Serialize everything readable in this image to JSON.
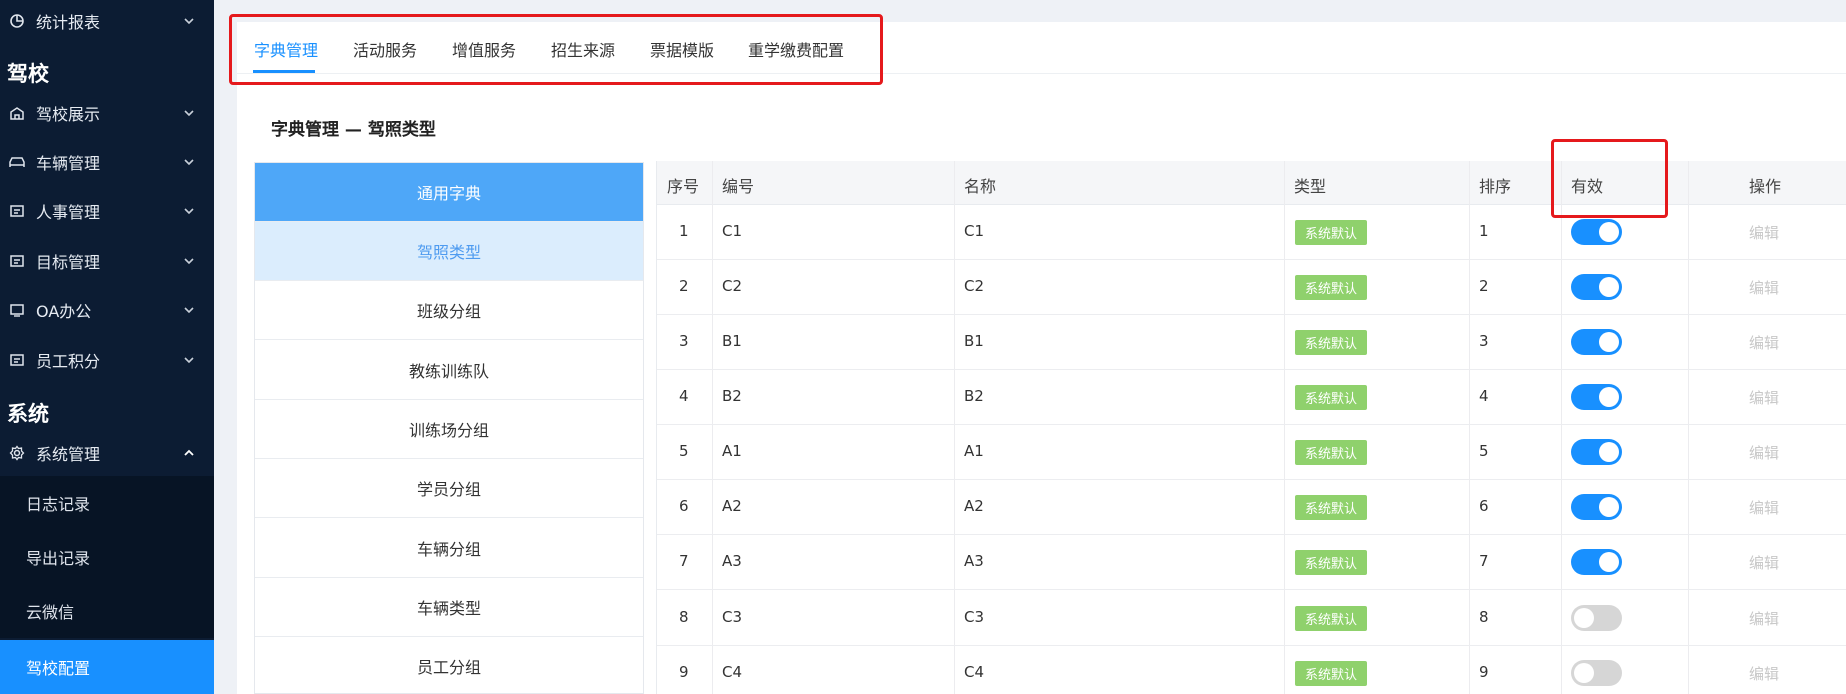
{
  "sidebar": {
    "top_item": {
      "label": "统计报表",
      "icon": "pie-chart-icon"
    },
    "section_school": "驾校",
    "school_items": [
      {
        "label": "驾校展示",
        "icon": "building-icon"
      },
      {
        "label": "车辆管理",
        "icon": "car-icon"
      },
      {
        "label": "人事管理",
        "icon": "id-card-icon"
      },
      {
        "label": "目标管理",
        "icon": "id-card-icon"
      },
      {
        "label": "OA办公",
        "icon": "oa-icon"
      },
      {
        "label": "员工积分",
        "icon": "id-card-icon"
      }
    ],
    "section_system": "系统",
    "system_item": {
      "label": "系统管理",
      "icon": "gear-icon"
    },
    "sub_items": [
      "日志记录",
      "导出记录",
      "云微信",
      "驾校配置"
    ],
    "active_sub": "驾校配置"
  },
  "tabs": [
    "字典管理",
    "活动服务",
    "增值服务",
    "招生来源",
    "票据模版",
    "重学缴费配置"
  ],
  "active_tab": "字典管理",
  "page_title": "字典管理 — 驾照类型",
  "dict_list": [
    "通用字典",
    "驾照类型",
    "班级分组",
    "教练训练队",
    "训练场分组",
    "学员分组",
    "车辆分组",
    "车辆类型",
    "员工分组"
  ],
  "table": {
    "headers": [
      "序号",
      "编号",
      "名称",
      "类型",
      "排序",
      "有效",
      "操作"
    ],
    "rows": [
      {
        "seq": "1",
        "code": "C1",
        "name": "C1",
        "type": "系统默认",
        "sort": "1",
        "enabled": true,
        "action": "编辑"
      },
      {
        "seq": "2",
        "code": "C2",
        "name": "C2",
        "type": "系统默认",
        "sort": "2",
        "enabled": true,
        "action": "编辑"
      },
      {
        "seq": "3",
        "code": "B1",
        "name": "B1",
        "type": "系统默认",
        "sort": "3",
        "enabled": true,
        "action": "编辑"
      },
      {
        "seq": "4",
        "code": "B2",
        "name": "B2",
        "type": "系统默认",
        "sort": "4",
        "enabled": true,
        "action": "编辑"
      },
      {
        "seq": "5",
        "code": "A1",
        "name": "A1",
        "type": "系统默认",
        "sort": "5",
        "enabled": true,
        "action": "编辑"
      },
      {
        "seq": "6",
        "code": "A2",
        "name": "A2",
        "type": "系统默认",
        "sort": "6",
        "enabled": true,
        "action": "编辑"
      },
      {
        "seq": "7",
        "code": "A3",
        "name": "A3",
        "type": "系统默认",
        "sort": "7",
        "enabled": true,
        "action": "编辑"
      },
      {
        "seq": "8",
        "code": "C3",
        "name": "C3",
        "type": "系统默认",
        "sort": "8",
        "enabled": false,
        "action": "编辑"
      },
      {
        "seq": "9",
        "code": "C4",
        "name": "C4",
        "type": "系统默认",
        "sort": "9",
        "enabled": false,
        "action": "编辑"
      }
    ]
  },
  "colors": {
    "accent": "#1890ff",
    "sidebar_bg": "#0c1c33",
    "badge_green": "#8fd16c",
    "highlight_red": "#e5191c"
  }
}
